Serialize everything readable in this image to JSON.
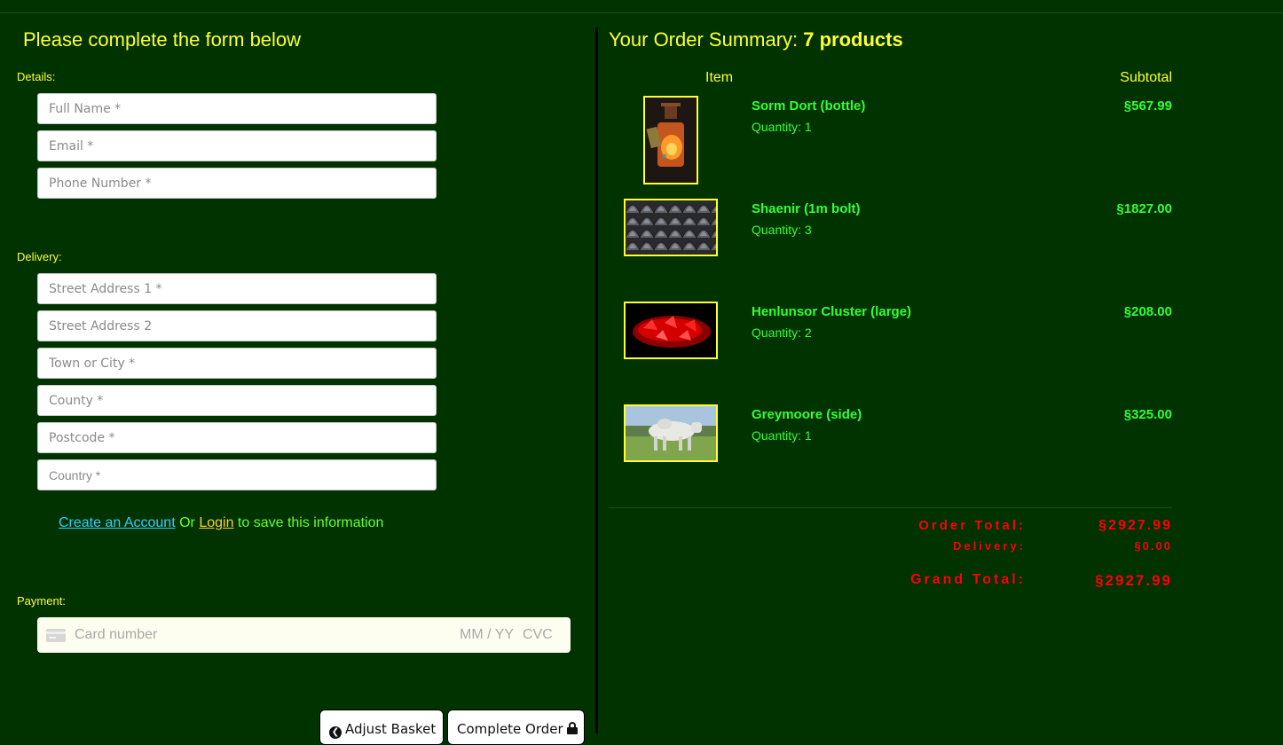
{
  "form": {
    "title": "Please complete the form below",
    "details_label": "Details:",
    "full_name_placeholder": "Full Name *",
    "email_placeholder": "Email *",
    "phone_placeholder": "Phone Number *",
    "delivery_label": "Delivery:",
    "street1_placeholder": "Street Address 1 *",
    "street2_placeholder": "Street Address 2",
    "town_placeholder": "Town or City *",
    "county_placeholder": "County *",
    "postcode_placeholder": "Postcode *",
    "country_placeholder": "Country *",
    "create_account_link": "Create an Account",
    "or_text": " Or ",
    "login_link": "Login",
    "save_text": " to save this information",
    "payment_label": "Payment:",
    "card_number_placeholder": "Card number",
    "card_expiry_placeholder": "MM / YY",
    "card_cvc_placeholder": "CVC",
    "adjust_basket_label": "Adjust Basket",
    "complete_order_label": "Complete Order"
  },
  "summary": {
    "title_prefix": "Your Order Summary: ",
    "product_count": "7 products",
    "col_item": "Item",
    "col_subtotal": "Subtotal",
    "items": [
      {
        "name": "Sorm Dort (bottle)",
        "quantity": "Quantity: 1",
        "price": "§567.99"
      },
      {
        "name": "Shaenir (1m bolt)",
        "quantity": "Quantity: 3",
        "price": "§1827.00"
      },
      {
        "name": "Henlunsor Cluster (large)",
        "quantity": "Quantity: 2",
        "price": "§208.00"
      },
      {
        "name": "Greymoore (side)",
        "quantity": "Quantity: 1",
        "price": "§325.00"
      }
    ],
    "order_total_label": "Order Total:",
    "order_total_value": "§2927.99",
    "delivery_label": "Delivery:",
    "delivery_value": "§0.00",
    "grand_total_label": "Grand Total:",
    "grand_total_value": "§2927.99"
  },
  "colors": {
    "background": "#003300",
    "heading": "#ffff33",
    "product_text": "#33ff33",
    "totals": "#ff0000",
    "account_link": "#33ccff",
    "login_link": "#ffcc33"
  },
  "icons": {
    "adjust_basket": "chevron-left-circle-icon",
    "complete_order": "lock-icon",
    "card": "credit-card-icon"
  }
}
